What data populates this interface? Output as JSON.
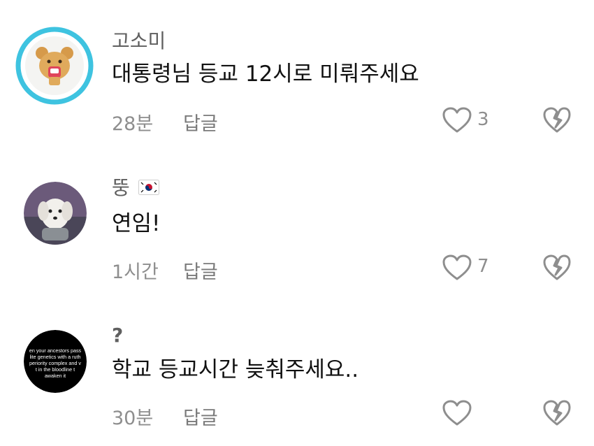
{
  "comments": [
    {
      "username": "고소미",
      "text": "대통령님 등교 12시로 미뤄주세요",
      "time": "28분",
      "reply_label": "답글",
      "like_count": "3"
    },
    {
      "username": "뚱",
      "text": "연임!",
      "time": "1시간",
      "reply_label": "답글",
      "like_count": "7"
    },
    {
      "username": "?",
      "text": "학교 등교시간 늦춰주세요..",
      "time": "30분",
      "reply_label": "답글",
      "like_count": "",
      "avatar_caption": [
        "en your ancestors pass",
        "lite genetics with a ruth",
        "periority complex and v",
        "t in the bloodline t",
        "awaken it"
      ]
    }
  ],
  "colors": {
    "avatar_ring": "#3ec3e0",
    "icon_stroke": "#8e8e8e",
    "text": "#111111",
    "meta": "#8e8e8e"
  },
  "icons": [
    "heart-outline-icon",
    "broken-heart-icon",
    "korean-flag-icon"
  ]
}
